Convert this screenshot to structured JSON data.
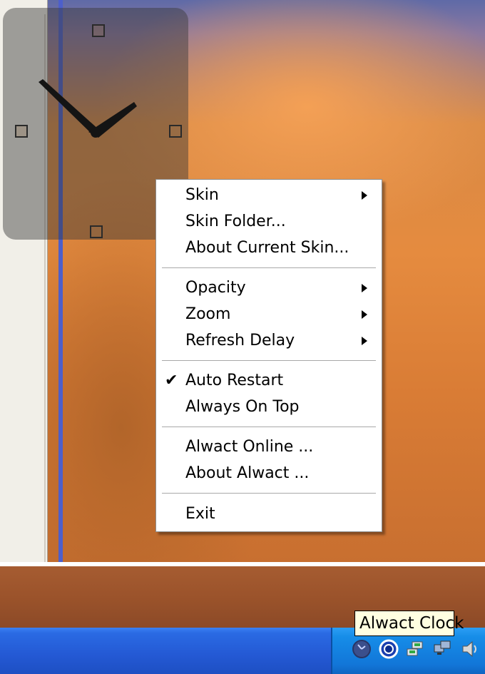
{
  "context_menu": {
    "items": [
      {
        "label": "Skin",
        "submenu": true
      },
      {
        "label": "Skin Folder..."
      },
      {
        "label": "About Current Skin..."
      },
      {
        "label": "Opacity",
        "submenu": true
      },
      {
        "label": "Zoom",
        "submenu": true
      },
      {
        "label": "Refresh Delay",
        "submenu": true
      },
      {
        "label": "Auto Restart",
        "checked": true
      },
      {
        "label": "Always On Top"
      },
      {
        "label": "Alwact Online ..."
      },
      {
        "label": "About Alwact ..."
      },
      {
        "label": "Exit"
      }
    ],
    "check_glyph": "✔"
  },
  "tooltip": {
    "text": "Alwact Clock"
  },
  "tray_icons": [
    "alwact-clock-tray-icon",
    "ring-tray-icon",
    "network-tray-icon",
    "monitor-tray-icon",
    "speaker-tray-icon"
  ],
  "colors": {
    "taskbar": "#2459d4",
    "tray": "#168de8",
    "tooltip_bg": "#ffffe1"
  }
}
